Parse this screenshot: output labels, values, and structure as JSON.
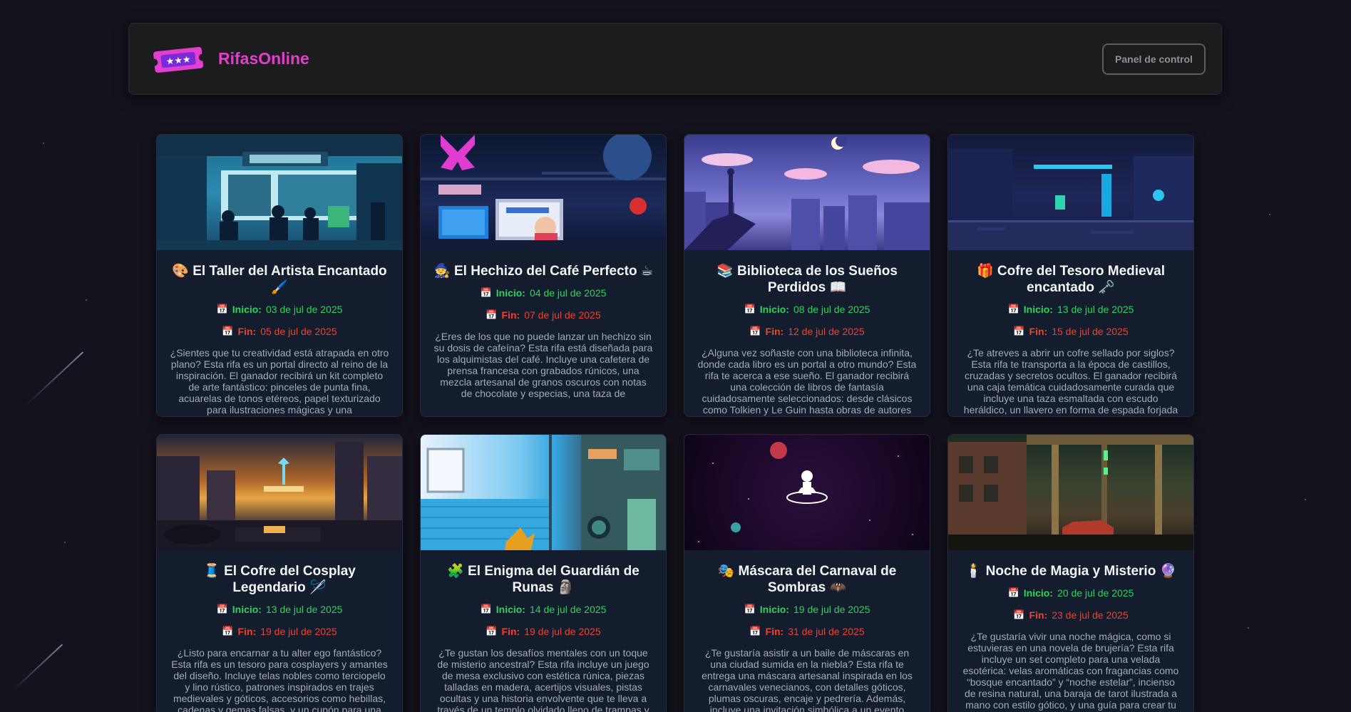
{
  "brand": {
    "name": "RifasOnline"
  },
  "nav": {
    "panel_button": "Panel de control"
  },
  "labels": {
    "start": "Inicio:",
    "end": "Fin:"
  },
  "cards": [
    {
      "title": "🎨 El Taller del Artista Encantado 🖌️",
      "start": "03 de jul de 2025",
      "end": "05 de jul de 2025",
      "description": "¿Sientes que tu creatividad está atrapada en otro plano? Esta rifa es un portal directo al reino de la inspiración. El ganador recibirá un kit completo de arte fantástico: pinceles de punta fina, acuarelas de tonos etéreos, papel texturizado para ilustraciones mágicas y una"
    },
    {
      "title": "🧙 El Hechizo del Café Perfecto ☕",
      "start": "04 de jul de 2025",
      "end": "07 de jul de 2025",
      "description": "¿Eres de los que no puede lanzar un hechizo sin su dosis de cafeína? Esta rifa está diseñada para los alquimistas del café. Incluye una cafetera de prensa francesa con grabados rúnicos, una mezcla artesanal de granos oscuros con notas de chocolate y especias, una taza de"
    },
    {
      "title": "📚 Biblioteca de los Sueños Perdidos 📖",
      "start": "08 de jul de 2025",
      "end": "12 de jul de 2025",
      "description": "¿Alguna vez soñaste con una biblioteca infinita, donde cada libro es un portal a otro mundo? Esta rifa te acerca a ese sueño. El ganador recibirá una colección de libros de fantasía cuidadosamente seleccionados: desde clásicos como Tolkien y Le Guin hasta obras de autores"
    },
    {
      "title": "🎁 Cofre del Tesoro Medieval encantado 🗝️",
      "start": "13 de jul de 2025",
      "end": "15 de jul de 2025",
      "description": "¿Te atreves a abrir un cofre sellado por siglos? Esta rifa te transporta a la época de castillos, cruzadas y secretos ocultos. El ganador recibirá una caja temática cuidadosamente curada que incluye una taza esmaltada con escudo heráldico, un llavero en forma de espada forjada"
    },
    {
      "title": "🧵 El Cofre del Cosplay Legendario 🪡",
      "start": "13 de jul de 2025",
      "end": "19 de jul de 2025",
      "description": "¿Listo para encarnar a tu alter ego fantástico? Esta rifa es un tesoro para cosplayers y amantes del diseño. Incluye telas nobles como terciopelo y lino rústico, patrones inspirados en trajes medievales y góticos, accesorios como hebillas, cadenas y gemas falsas, y un cupón para una"
    },
    {
      "title": "🧩 El Enigma del Guardián de Runas 🗿",
      "start": "14 de jul de 2025",
      "end": "19 de jul de 2025",
      "description": "¿Te gustan los desafíos mentales con un toque de misterio ancestral? Esta rifa incluye un juego de mesa exclusivo con estética rúnica, piezas talladas en madera, acertijos visuales, pistas ocultas y una historia envolvente que te lleva a través de un templo olvidado lleno de trampas y"
    },
    {
      "title": "🎭 Máscara del Carnaval de Sombras 🦇",
      "start": "19 de jul de 2025",
      "end": "31 de jul de 2025",
      "description": "¿Te gustaría asistir a un baile de máscaras en una ciudad sumida en la niebla? Esta rifa te entrega una máscara artesanal inspirada en los carnavales venecianos, con detalles góticos, plumas oscuras, encaje y pedrería. Además, incluye una invitación simbólica a un evento"
    },
    {
      "title": "🕯️ Noche de Magia y Misterio 🔮",
      "start": "20 de jul de 2025",
      "end": "23 de jul de 2025",
      "description": "¿Te gustaría vivir una noche mágica, como si estuvieras en una novela de brujería? Esta rifa incluye un set completo para una velada esotérica: velas aromáticas con fragancias como “bosque encantado” y “noche estelar”, incienso de resina natural, una baraja de tarot ilustrada a mano con estilo gótico, y una guía para crear tu"
    }
  ]
}
